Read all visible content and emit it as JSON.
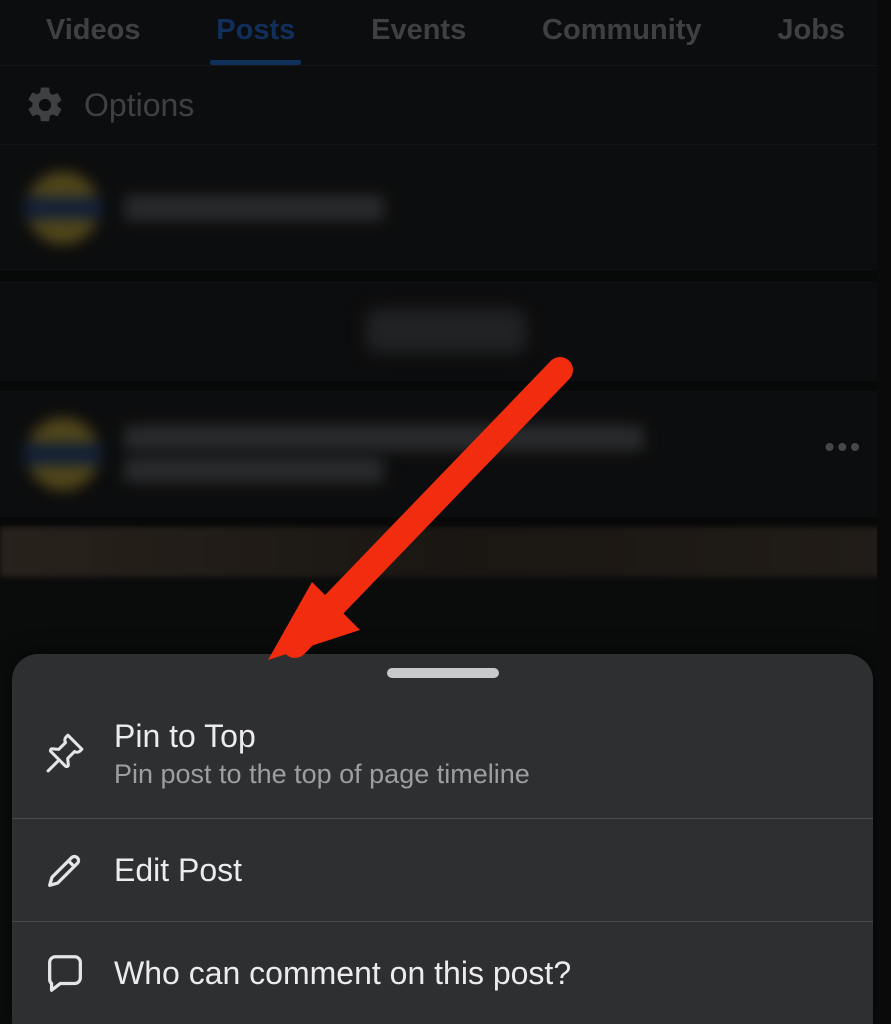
{
  "tabs": {
    "items": [
      {
        "label": "Videos",
        "active": false
      },
      {
        "label": "Posts",
        "active": true
      },
      {
        "label": "Events",
        "active": false
      },
      {
        "label": "Community",
        "active": false
      },
      {
        "label": "Jobs",
        "active": false
      }
    ]
  },
  "options": {
    "label": "Options"
  },
  "sheet": {
    "items": [
      {
        "icon": "pin-icon",
        "title": "Pin to Top",
        "sub": "Pin post to the top of page timeline"
      },
      {
        "icon": "pencil-icon",
        "title": "Edit Post",
        "sub": ""
      },
      {
        "icon": "comment-icon",
        "title": "Who can comment on this post?",
        "sub": ""
      }
    ]
  },
  "annotation": {
    "color": "#f12c0f"
  }
}
